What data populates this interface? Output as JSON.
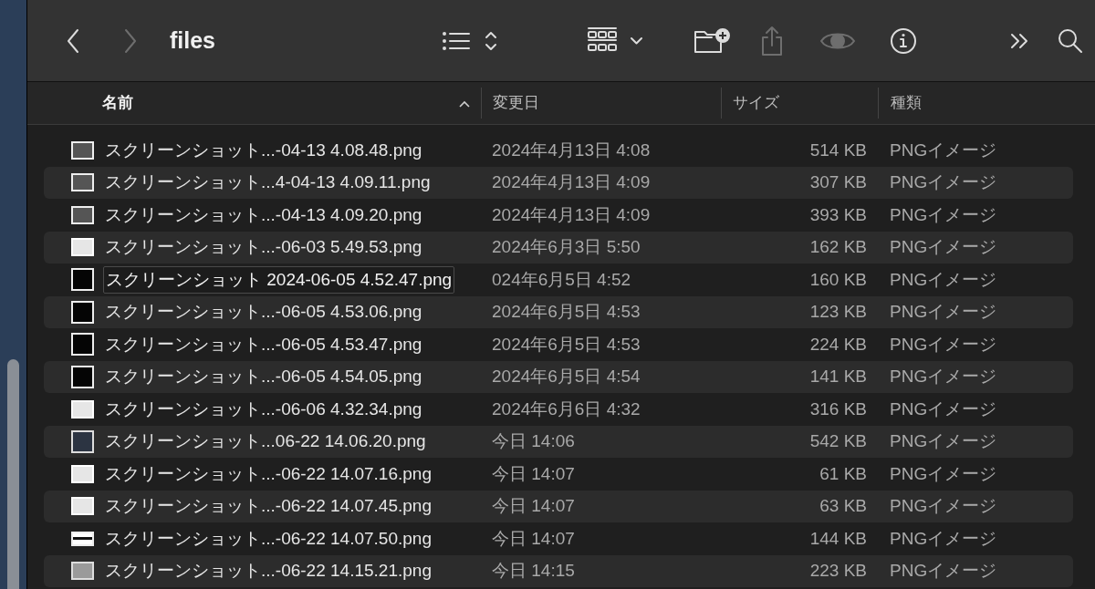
{
  "window": {
    "title": "files"
  },
  "toolbar": [
    {
      "kind": "back",
      "disabled": false
    },
    {
      "kind": "forward",
      "disabled": true
    },
    {
      "kind": "list-view",
      "disabled": false
    },
    {
      "kind": "sort-toggle",
      "disabled": false
    },
    {
      "kind": "group-view",
      "disabled": false
    },
    {
      "kind": "group-menu",
      "disabled": false
    },
    {
      "kind": "new-folder",
      "disabled": false
    },
    {
      "kind": "share",
      "disabled": true
    },
    {
      "kind": "preview",
      "disabled": true
    },
    {
      "kind": "info",
      "disabled": false
    },
    {
      "kind": "more",
      "disabled": false
    },
    {
      "kind": "search",
      "disabled": false
    }
  ],
  "columns": [
    {
      "label": "名前",
      "sorted": true
    },
    {
      "label": "変更日",
      "sorted": false
    },
    {
      "label": "サイズ",
      "sorted": false
    },
    {
      "label": "種類",
      "sorted": false
    }
  ],
  "rows": [
    {
      "kind": "framed",
      "name": "スクリーンショット...-04-13 4.08.48.png",
      "date": "2024年4月13日 4:08",
      "size": "514 KB",
      "type": "PNGイメージ",
      "expanded": false
    },
    {
      "kind": "framed",
      "name": "スクリーンショット...4-04-13 4.09.11.png",
      "date": "2024年4月13日 4:09",
      "size": "307 KB",
      "type": "PNGイメージ",
      "expanded": false
    },
    {
      "kind": "framed",
      "name": "スクリーンショット...-04-13 4.09.20.png",
      "date": "2024年4月13日 4:09",
      "size": "393 KB",
      "type": "PNGイメージ",
      "expanded": false
    },
    {
      "kind": "light",
      "name": "スクリーンショット...-06-03 5.49.53.png",
      "date": "2024年6月3日 5:50",
      "size": "162 KB",
      "type": "PNGイメージ",
      "expanded": false
    },
    {
      "kind": "dark",
      "name": "スクリーンショット 2024-06-05 4.52.47.png",
      "date": "024年6月5日 4:52",
      "size": "160 KB",
      "type": "PNGイメージ",
      "expanded": true
    },
    {
      "kind": "dark",
      "name": "スクリーンショット...-06-05 4.53.06.png",
      "date": "2024年6月5日 4:53",
      "size": "123 KB",
      "type": "PNGイメージ",
      "expanded": false
    },
    {
      "kind": "dark",
      "name": "スクリーンショット...-06-05 4.53.47.png",
      "date": "2024年6月5日 4:53",
      "size": "224 KB",
      "type": "PNGイメージ",
      "expanded": false
    },
    {
      "kind": "dark",
      "name": "スクリーンショット...-06-05 4.54.05.png",
      "date": "2024年6月5日 4:54",
      "size": "141 KB",
      "type": "PNGイメージ",
      "expanded": false
    },
    {
      "kind": "light",
      "name": "スクリーンショット...-06-06 4.32.34.png",
      "date": "2024年6月6日 4:32",
      "size": "316 KB",
      "type": "PNGイメージ",
      "expanded": false
    },
    {
      "kind": "blue",
      "name": "スクリーンショット...06-22 14.06.20.png",
      "date": "今日 14:06",
      "size": "542 KB",
      "type": "PNGイメージ",
      "expanded": false
    },
    {
      "kind": "light",
      "name": "スクリーンショット...-06-22 14.07.16.png",
      "date": "今日 14:07",
      "size": "61 KB",
      "type": "PNGイメージ",
      "expanded": false
    },
    {
      "kind": "light",
      "name": "スクリーンショット...-06-22 14.07.45.png",
      "date": "今日 14:07",
      "size": "63 KB",
      "type": "PNGイメージ",
      "expanded": false
    },
    {
      "kind": "band",
      "name": "スクリーンショット...-06-22 14.07.50.png",
      "date": "今日 14:07",
      "size": "144 KB",
      "type": "PNGイメージ",
      "expanded": false
    },
    {
      "kind": "gray",
      "name": "スクリーンショット...-06-22 14.15.21.png",
      "date": "今日 14:15",
      "size": "223 KB",
      "type": "PNGイメージ",
      "expanded": false
    }
  ]
}
